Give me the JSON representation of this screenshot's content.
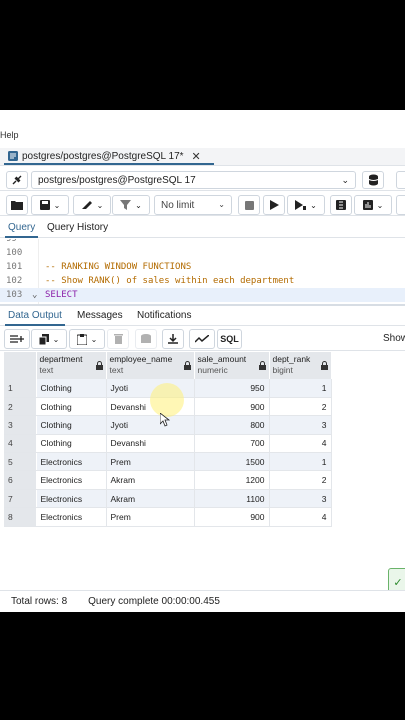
{
  "menubar": {
    "help_label": "Help"
  },
  "tab": {
    "title": "postgres/postgres@PostgreSQL 17*",
    "close_icon": "close-icon"
  },
  "connection": {
    "value": "postgres/postgres@PostgreSQL 17"
  },
  "toolbar": {
    "limit_value": "No limit"
  },
  "query_tabs": [
    {
      "label": "Query",
      "active": true
    },
    {
      "label": "Query History",
      "active": false
    }
  ],
  "editor": {
    "lines": [
      {
        "num": "99",
        "code": ""
      },
      {
        "num": "100",
        "code": ""
      },
      {
        "num": "101",
        "code": "-- RANKING WINDOW FUNCTIONS"
      },
      {
        "num": "102",
        "code": "-- Show RANK() of sales within each department"
      },
      {
        "num": "103",
        "fold": "⌄",
        "code": "SELECT"
      }
    ]
  },
  "output_tabs": [
    {
      "label": "Data Output",
      "active": true
    },
    {
      "label": "Messages",
      "active": false
    },
    {
      "label": "Notifications",
      "active": false
    }
  ],
  "output_toolbar": {
    "sql_label": "SQL",
    "show_label": "Show"
  },
  "grid": {
    "columns": [
      {
        "name": "department",
        "type": "text"
      },
      {
        "name": "employee_name",
        "type": "text"
      },
      {
        "name": "sale_amount",
        "type": "numeric"
      },
      {
        "name": "dept_rank",
        "type": "bigint"
      }
    ],
    "rows": [
      {
        "n": "1",
        "department": "Clothing",
        "employee_name": "Jyoti",
        "sale_amount": "950",
        "dept_rank": "1"
      },
      {
        "n": "2",
        "department": "Clothing",
        "employee_name": "Devanshi",
        "sale_amount": "900",
        "dept_rank": "2"
      },
      {
        "n": "3",
        "department": "Clothing",
        "employee_name": "Jyoti",
        "sale_amount": "800",
        "dept_rank": "3"
      },
      {
        "n": "4",
        "department": "Clothing",
        "employee_name": "Devanshi",
        "sale_amount": "700",
        "dept_rank": "4"
      },
      {
        "n": "5",
        "department": "Electronics",
        "employee_name": "Prem",
        "sale_amount": "1500",
        "dept_rank": "1"
      },
      {
        "n": "6",
        "department": "Electronics",
        "employee_name": "Akram",
        "sale_amount": "1200",
        "dept_rank": "2"
      },
      {
        "n": "7",
        "department": "Electronics",
        "employee_name": "Akram",
        "sale_amount": "1100",
        "dept_rank": "3"
      },
      {
        "n": "8",
        "department": "Electronics",
        "employee_name": "Prem",
        "sale_amount": "900",
        "dept_rank": "4"
      }
    ]
  },
  "status": {
    "total_rows": "Total rows: 8",
    "query_status": "Query complete 00:00:00.455"
  },
  "colors": {
    "accent": "#326690",
    "header_bg": "#e4e7eb",
    "row_alt": "#eef2f8",
    "success": "#2c8a2c"
  }
}
